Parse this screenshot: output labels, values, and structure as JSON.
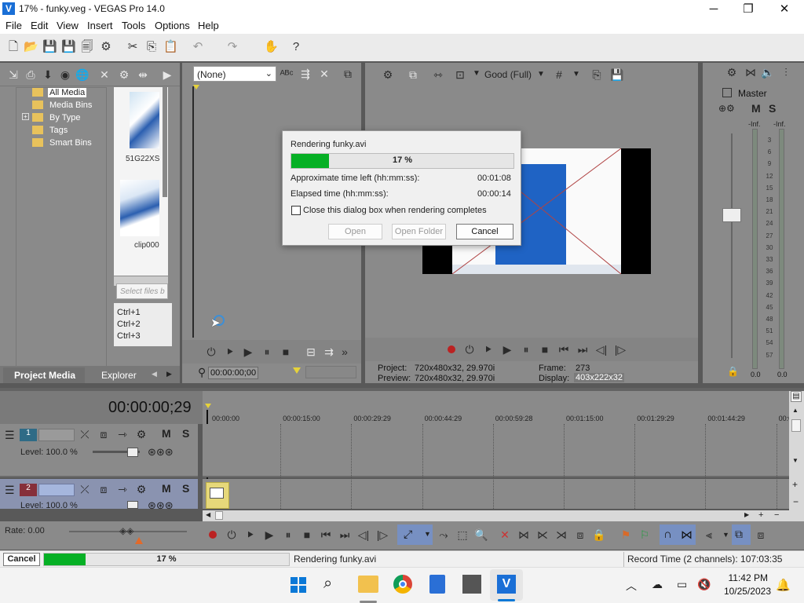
{
  "window": {
    "title": "17% - funky.veg - VEGAS Pro 14.0",
    "minimize": "─",
    "maximize": "❐",
    "close": "✕"
  },
  "menu": [
    "File",
    "Edit",
    "View",
    "Insert",
    "Tools",
    "Options",
    "Help"
  ],
  "media_tree": [
    "All Media",
    "Media Bins",
    "By Type",
    "Tags",
    "Smart Bins"
  ],
  "media_items": [
    "51G22XS",
    "clip000"
  ],
  "search_placeholder": "Select files b",
  "shortcuts": [
    "Ctrl+1",
    "Ctrl+2",
    "Ctrl+3"
  ],
  "tabs": {
    "project_media": "Project Media",
    "explorer": "Explorer"
  },
  "trimmer": {
    "dropdown": "(None)",
    "timecode": "00:00:00;00"
  },
  "preview": {
    "quality": "Good (Full)",
    "project_label": "Project:",
    "project_value": "720x480x32, 29.970i",
    "preview_label": "Preview:",
    "preview_value": "720x480x32, 29.970i",
    "frame_label": "Frame:",
    "frame_value": "273",
    "display_label": "Display:",
    "display_value": "403x222x32"
  },
  "master": {
    "title": "Master",
    "m": "M",
    "s": "S",
    "inf_left": "-Inf.",
    "inf_right": "-Inf.",
    "scale": [
      "3",
      "6",
      "9",
      "12",
      "15",
      "18",
      "21",
      "24",
      "27",
      "30",
      "33",
      "36",
      "39",
      "42",
      "45",
      "48",
      "51",
      "54",
      "57"
    ],
    "val_left": "0.0",
    "val_right": "0.0"
  },
  "dialog": {
    "title": "Rendering funky.avi",
    "percent": "17 %",
    "progress": 0.17,
    "time_left_label": "Approximate time left (hh:mm:ss):",
    "time_left": "00:01:08",
    "elapsed_label": "Elapsed time (hh:mm:ss):",
    "elapsed": "00:00:14",
    "checkbox_label": "Close this dialog box when rendering completes",
    "open": "Open",
    "open_folder": "Open Folder",
    "cancel": "Cancel"
  },
  "timeline": {
    "timecode": "00:00:00;29",
    "ruler": [
      "00:00:00",
      "00:00:15:00",
      "00:00:29:29",
      "00:00:44:29",
      "00:00:59:28",
      "00:01:15:00",
      "00:01:29:29",
      "00:01:44:29",
      "00:0"
    ],
    "tracks": [
      {
        "num": "1",
        "level": "Level: 100.0 %"
      },
      {
        "num": "2",
        "level": "Level: 100.0 %"
      }
    ],
    "m": "M",
    "s": "S",
    "rate": "Rate: 0.00"
  },
  "status": {
    "cancel": "Cancel",
    "percent": "17 %",
    "progress": 0.17,
    "message": "Rendering funky.avi",
    "record_time": "Record Time (2 channels): 107:03:35"
  },
  "taskbar": {
    "time": "11:42 PM",
    "date": "10/25/2023"
  }
}
